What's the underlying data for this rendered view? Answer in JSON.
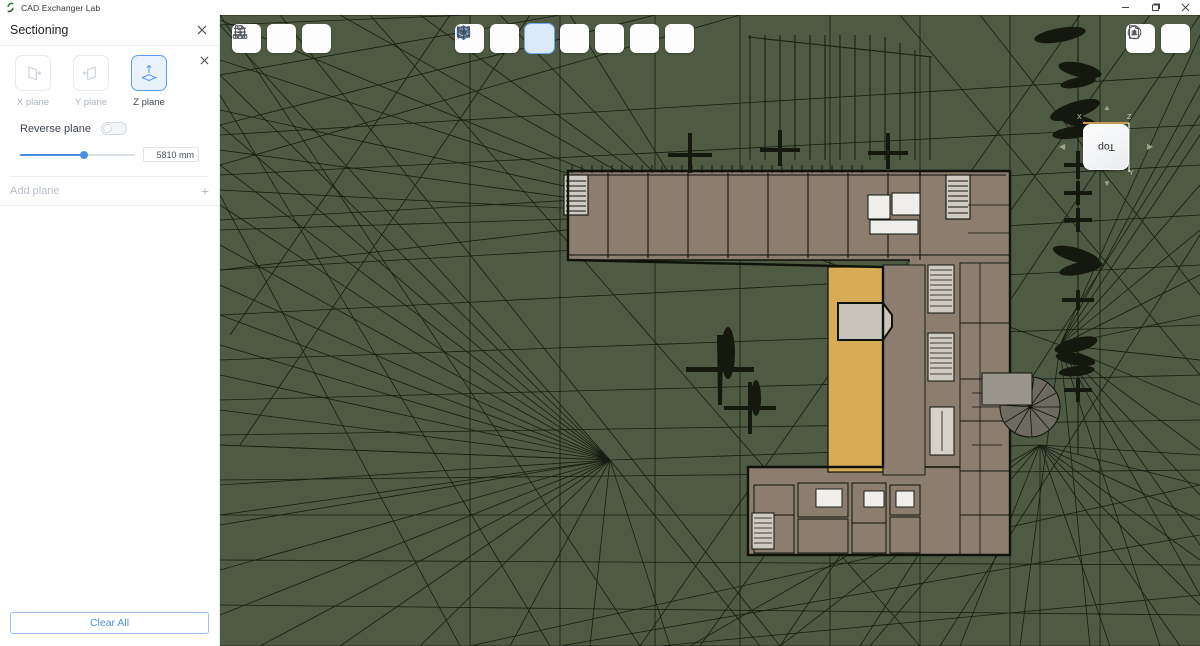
{
  "window": {
    "app_title": "CAD Exchanger Lab",
    "logo_icon": "cad-exchanger-logo",
    "controls": [
      {
        "name": "minimize-button",
        "icon": "minimize-icon"
      },
      {
        "name": "maximize-button",
        "icon": "restore-icon"
      },
      {
        "name": "close-button",
        "icon": "close-icon"
      }
    ]
  },
  "panel": {
    "title": "Sectioning",
    "close_icon": "close-icon",
    "plane": {
      "close_icon": "close-icon",
      "types": [
        {
          "label": "X plane",
          "icon": "x-plane-icon",
          "active": false
        },
        {
          "label": "Y plane",
          "icon": "y-plane-icon",
          "active": false
        },
        {
          "label": "Z plane",
          "icon": "z-plane-icon",
          "active": true
        }
      ],
      "reverse_label": "Reverse plane",
      "reverse_on": false,
      "slider_percent": 56,
      "value": "5810 mm"
    },
    "add_plane_label": "Add plane",
    "add_plane_icon": "plus-icon",
    "clear_all_label": "Clear All",
    "accent_color": "#4a90e2"
  },
  "toolbar": {
    "left": [
      {
        "name": "menu-button",
        "icon": "hamburger-menu-icon"
      },
      {
        "name": "structure-tree-button",
        "icon": "model-tree-icon"
      },
      {
        "name": "file-convert-button",
        "icon": "file-exchange-icon"
      }
    ],
    "center": [
      {
        "name": "shaded-view-button",
        "icon": "cube-wireframe-icon",
        "active": false
      },
      {
        "name": "measure-button",
        "icon": "bounding-box-measure-icon",
        "active": false
      },
      {
        "name": "sectioning-button",
        "icon": "cube-section-icon",
        "active": true
      },
      {
        "name": "explode-button",
        "icon": "cube-explode-icon",
        "active": false
      },
      {
        "name": "clip-planes-button",
        "icon": "clip-plane-icon",
        "active": false
      },
      {
        "name": "visibility-button",
        "icon": "eye-focus-icon",
        "active": false
      },
      {
        "name": "zoom-fit-button",
        "icon": "zoom-magnifier-icon",
        "active": false
      }
    ],
    "right": [
      {
        "name": "properties-button",
        "icon": "document-properties-icon"
      },
      {
        "name": "notifications-button",
        "icon": "bell-circle-icon"
      }
    ]
  },
  "viewcube": {
    "label": "Top",
    "axes": {
      "x": "X",
      "y": "Y",
      "z": "Z"
    },
    "arrows": [
      "arrow-up-icon",
      "arrow-down-icon",
      "arrow-left-icon",
      "arrow-right-icon"
    ]
  },
  "viewport": {
    "background_color": "#4e5a43",
    "mesh_line_color": "#14180f",
    "model_name": "building-floorplan-3d-model",
    "floor_color": "#8b7e70",
    "highlight_color": "#d8ab55"
  }
}
